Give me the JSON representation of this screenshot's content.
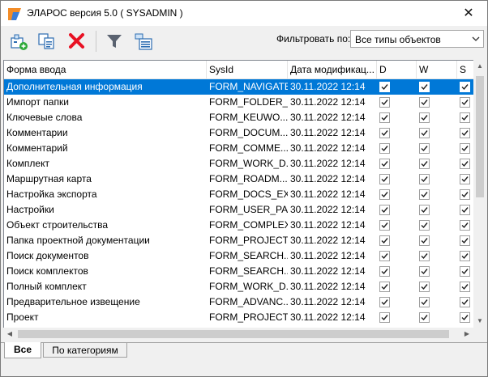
{
  "window": {
    "title": "ЭЛАРОС версия 5.0 ( SYSADMIN )",
    "close_glyph": "✕"
  },
  "toolbar": {
    "buttons": [
      {
        "name": "add-object-icon"
      },
      {
        "name": "copy-object-icon"
      },
      {
        "name": "delete-icon"
      },
      {
        "name": "filter-icon"
      },
      {
        "name": "settings-list-icon"
      }
    ],
    "filter_label": "Фильтровать по:",
    "filter_value": "Все типы объектов"
  },
  "grid": {
    "columns": [
      "Форма ввода",
      "SysId",
      "Дата модификац...",
      "D",
      "W",
      "S"
    ],
    "rows": [
      {
        "form": "Дополнительная информация",
        "sysid": "FORM_NAVIGATE",
        "date": "30.11.2022 12:14",
        "d": true,
        "w": true,
        "s": true,
        "selected": true
      },
      {
        "form": "Импорт папки",
        "sysid": "FORM_FOLDER_...",
        "date": "30.11.2022 12:14",
        "d": true,
        "w": true,
        "s": true
      },
      {
        "form": "Ключевые слова",
        "sysid": "FORM_KEUWO...",
        "date": "30.11.2022 12:14",
        "d": true,
        "w": true,
        "s": true
      },
      {
        "form": "Комментарии",
        "sysid": "FORM_DOCUM...",
        "date": "30.11.2022 12:14",
        "d": true,
        "w": true,
        "s": true
      },
      {
        "form": "Комментарий",
        "sysid": "FORM_COMME...",
        "date": "30.11.2022 12:14",
        "d": true,
        "w": true,
        "s": true
      },
      {
        "form": "Комплект",
        "sysid": "FORM_WORK_D...",
        "date": "30.11.2022 12:14",
        "d": true,
        "w": true,
        "s": true
      },
      {
        "form": "Маршрутная карта",
        "sysid": "FORM_ROADM...",
        "date": "30.11.2022 12:14",
        "d": true,
        "w": true,
        "s": true
      },
      {
        "form": "Настройка экспорта",
        "sysid": "FORM_DOCS_EXP",
        "date": "30.11.2022 12:14",
        "d": true,
        "w": true,
        "s": true
      },
      {
        "form": "Настройки",
        "sysid": "FORM_USER_PA...",
        "date": "30.11.2022 12:14",
        "d": true,
        "w": true,
        "s": true
      },
      {
        "form": "Объект строительства",
        "sysid": "FORM_COMPLEX",
        "date": "30.11.2022 12:14",
        "d": true,
        "w": true,
        "s": true
      },
      {
        "form": "Папка проектной документации",
        "sysid": "FORM_PROJECT...",
        "date": "30.11.2022 12:14",
        "d": true,
        "w": true,
        "s": true
      },
      {
        "form": "Поиск документов",
        "sysid": "FORM_SEARCH...",
        "date": "30.11.2022 12:14",
        "d": true,
        "w": true,
        "s": true
      },
      {
        "form": "Поиск комплектов",
        "sysid": "FORM_SEARCH...",
        "date": "30.11.2022 12:14",
        "d": true,
        "w": true,
        "s": true
      },
      {
        "form": "Полный комплект",
        "sysid": "FORM_WORK_D...",
        "date": "30.11.2022 12:14",
        "d": true,
        "w": true,
        "s": true
      },
      {
        "form": "Предварительное извещение",
        "sysid": "FORM_ADVANC...",
        "date": "30.11.2022 12:14",
        "d": true,
        "w": true,
        "s": true
      },
      {
        "form": "Проект",
        "sysid": "FORM_PROJECT",
        "date": "30.11.2022 12:14",
        "d": true,
        "w": true,
        "s": true
      }
    ]
  },
  "tabs": [
    "Все",
    "По категориям"
  ],
  "colors": {
    "selection": "#0078d7",
    "delete": "#e81123",
    "toolbar_blue": "#2b6cb0",
    "add_green": "#2eaa3a"
  }
}
